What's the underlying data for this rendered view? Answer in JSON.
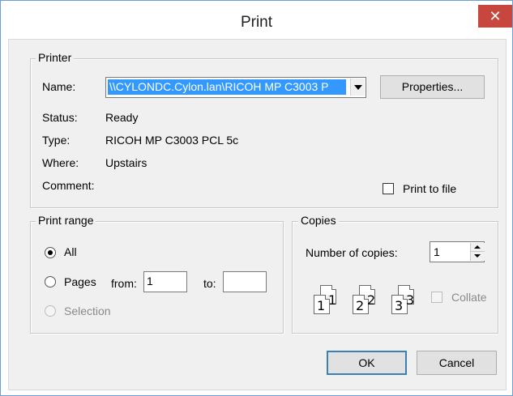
{
  "window": {
    "title": "Print",
    "close_glyph": "✕"
  },
  "printer": {
    "group_label": "Printer",
    "name_label": "Name:",
    "name_value": "\\\\CYLONDC.Cylon.lan\\RICOH MP C3003 P",
    "properties_label": "Properties...",
    "status_label": "Status:",
    "status_value": "Ready",
    "type_label": "Type:",
    "type_value": "RICOH MP C3003 PCL 5c",
    "where_label": "Where:",
    "where_value": "Upstairs",
    "comment_label": "Comment:",
    "comment_value": "",
    "print_to_file_label": "Print to file",
    "print_to_file_checked": false
  },
  "print_range": {
    "group_label": "Print range",
    "all_label": "All",
    "all_selected": true,
    "pages_label": "Pages",
    "from_label": "from:",
    "from_value": "1",
    "to_label": "to:",
    "to_value": "",
    "selection_label": "Selection"
  },
  "copies": {
    "group_label": "Copies",
    "number_label": "Number of copies:",
    "number_value": "1",
    "collate_label": "Collate",
    "collate_enabled": false,
    "icon_numbers": [
      "1",
      "1",
      "2",
      "2",
      "3",
      "3"
    ]
  },
  "buttons": {
    "ok": "OK",
    "cancel": "Cancel"
  },
  "icons": {
    "close": "close-icon",
    "dropdown": "chevron-down-icon",
    "spin_up": "spin-up-icon",
    "spin_down": "spin-down-icon",
    "collate": "collate-pages-icon"
  }
}
